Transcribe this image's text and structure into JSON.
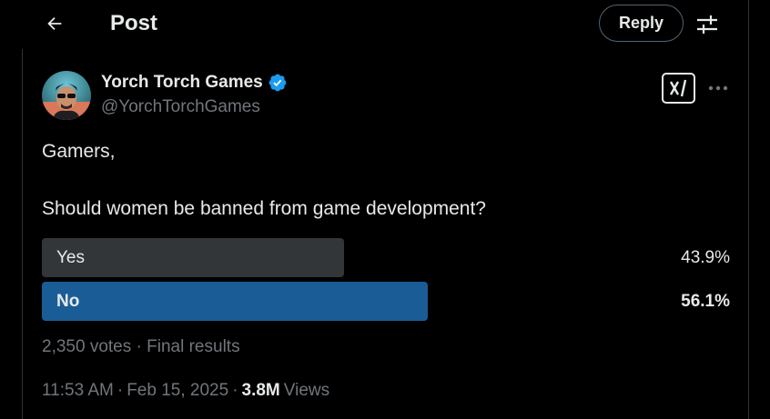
{
  "header": {
    "title": "Post",
    "reply_label": "Reply"
  },
  "author": {
    "name": "Yorch Torch Games",
    "handle": "@YorchTorchGames",
    "verified": true
  },
  "tweet": {
    "line1": "Gamers,",
    "line2": "Should women be banned from game development?"
  },
  "poll": {
    "options": [
      {
        "label": "Yes",
        "percent_text": "43.9%",
        "percent": 43.9,
        "winner": false
      },
      {
        "label": "No",
        "percent_text": "56.1%",
        "percent": 56.1,
        "winner": true
      }
    ],
    "votes_text": "2,350 votes",
    "separator": "·",
    "status": "Final results"
  },
  "meta": {
    "time": "11:53 AM",
    "sep1": "·",
    "date": "Feb 15, 2025",
    "sep2": "·",
    "views_count": "3.8M",
    "views_label": "Views"
  },
  "colors": {
    "accent": "#1d9bf0",
    "winner_bar": "#1a5c96",
    "loser_bar": "#333639",
    "muted_text": "#71767b"
  },
  "icons": [
    "back-arrow-icon",
    "sliders-icon",
    "verified-badge-icon",
    "grok-icon",
    "more-dots-icon"
  ]
}
